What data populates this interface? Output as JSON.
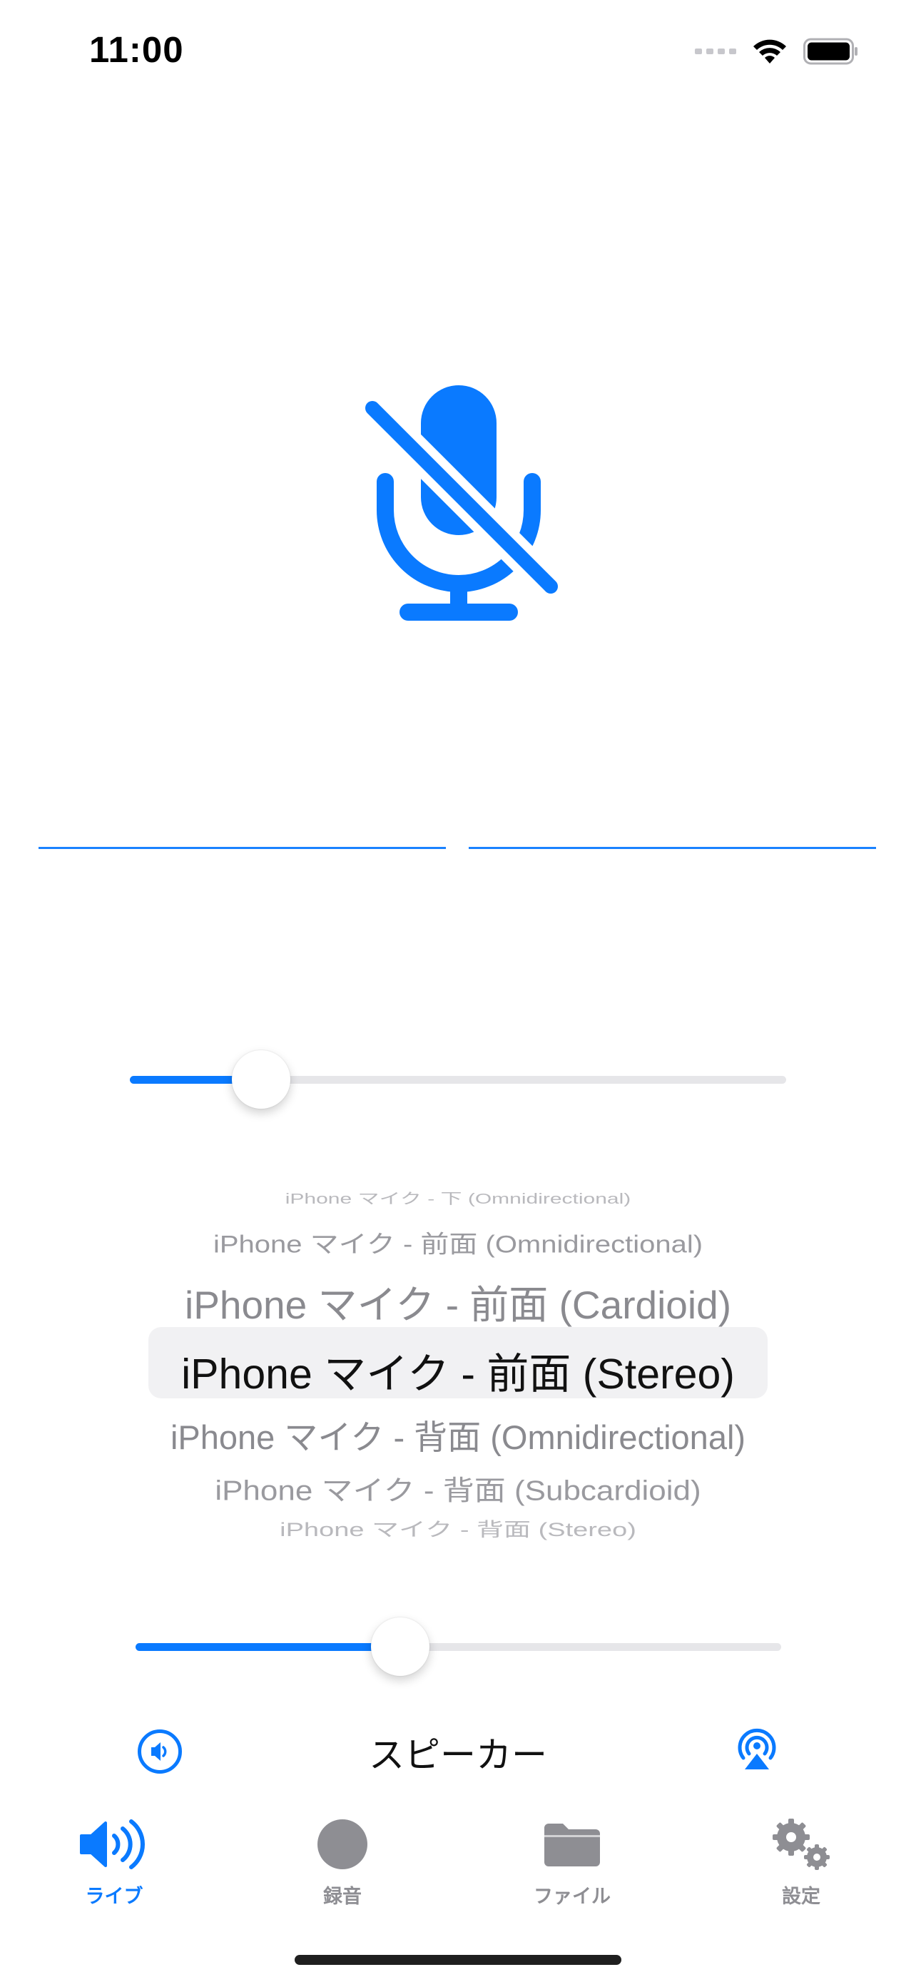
{
  "status_bar": {
    "time": "11:00"
  },
  "colors": {
    "accent": "#0a7aff",
    "inactive_tab": "#8e8e93",
    "track": "#e6e6e9"
  },
  "sliders": {
    "gain_fraction": 0.2,
    "volume_fraction": 0.41
  },
  "picker": {
    "options": [
      "iPhone マイク - 下 (Omnidirectional)",
      "iPhone マイク - 前面 (Omnidirectional)",
      "iPhone マイク - 前面 (Cardioid)",
      "iPhone マイク - 前面 (Stereo)",
      "iPhone マイク - 背面 (Omnidirectional)",
      "iPhone マイク - 背面 (Subcardioid)",
      "iPhone マイク - 背面 (Stereo)"
    ],
    "selected_index": 3
  },
  "output": {
    "label": "スピーカー",
    "left_icon": "speaker-icon",
    "right_icon": "airplay-audio-icon"
  },
  "tabs": [
    {
      "label": "ライブ",
      "icon": "speaker-wave-icon",
      "active": true
    },
    {
      "label": "録音",
      "icon": "record-circle-icon",
      "active": false
    },
    {
      "label": "ファイル",
      "icon": "folder-icon",
      "active": false
    },
    {
      "label": "設定",
      "icon": "gears-icon",
      "active": false
    }
  ]
}
